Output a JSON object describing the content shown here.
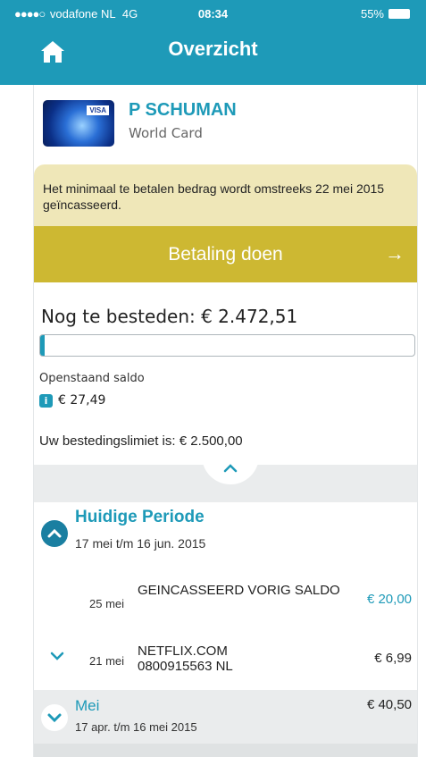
{
  "status_bar": {
    "signal_dots": "●●●●○",
    "carrier": "vodafone NL",
    "network": "4G",
    "time": "08:34",
    "battery": "55%"
  },
  "header": {
    "title": "Overzicht",
    "home_icon": "home-icon"
  },
  "card": {
    "holder": "P SCHUMAN",
    "type": "World Card",
    "brand_mark": "VISA"
  },
  "notice": {
    "text": "Het minimaal te betalen bedrag wordt omstreeks 22 mei 2015 geïncasseerd."
  },
  "pay_button": {
    "label": "Betaling doen",
    "arrow": "→"
  },
  "balance": {
    "remaining_label": "Nog te besteden: € 2.472,51",
    "progress_fraction": 0.011,
    "open_label": "Openstaand saldo",
    "info_icon": "i",
    "open_amount": "€ 27,49",
    "limit_label": "Uw bestedingslimiet is: € 2.500,00"
  },
  "periods": [
    {
      "title": "Huidige Periode",
      "range": "17 mei t/m 16 jun. 2015",
      "transactions": [
        {
          "date": "25 mei",
          "description": "GEINCASSEERD VORIG SALDO",
          "amount": "€ 20,00"
        },
        {
          "date": "21 mei",
          "description_line1": "NETFLIX.COM",
          "description_line2": "0800915563 NL",
          "amount": "€ 6,99"
        }
      ]
    },
    {
      "title": "Mei",
      "range": "17 apr. t/m 16 mei 2015",
      "amount": "€ 40,50"
    }
  ],
  "colors": {
    "brand": "#1e9ab8",
    "notice_bg": "#efe7b8",
    "pay_button": "#cdb832",
    "band": "#eaeced"
  }
}
